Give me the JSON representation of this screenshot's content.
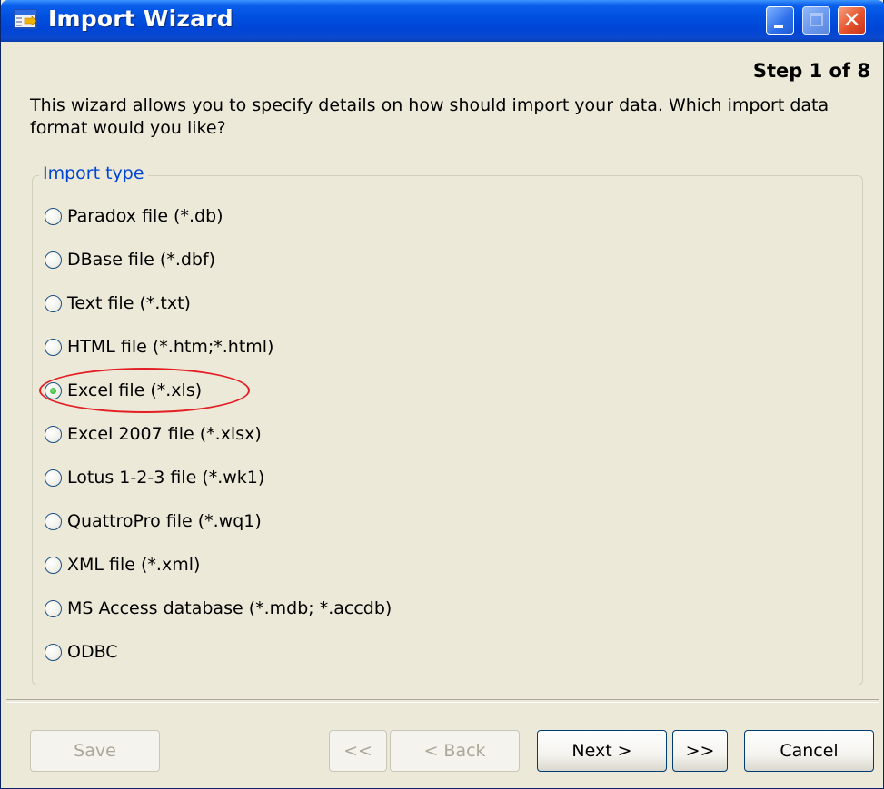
{
  "window": {
    "title": "Import Wizard",
    "step": "Step 1 of 8",
    "description": "This wizard allows you to specify details on how should import your data. Which import data format would you like?"
  },
  "import_type": {
    "label": "Import type",
    "selected": "Excel file (*.xls)",
    "options": [
      {
        "label": "Paradox file (*.db)",
        "checked": false
      },
      {
        "label": "DBase file (*.dbf)",
        "checked": false
      },
      {
        "label": "Text file (*.txt)",
        "checked": false
      },
      {
        "label": "HTML file (*.htm;*.html)",
        "checked": false
      },
      {
        "label": "Excel file (*.xls)",
        "checked": true
      },
      {
        "label": "Excel 2007 file (*.xlsx)",
        "checked": false
      },
      {
        "label": "Lotus 1-2-3 file (*.wk1)",
        "checked": false
      },
      {
        "label": "QuattroPro file (*.wq1)",
        "checked": false
      },
      {
        "label": "XML file (*.xml)",
        "checked": false
      },
      {
        "label": "MS Access database (*.mdb; *.accdb)",
        "checked": false
      },
      {
        "label": "ODBC",
        "checked": false
      }
    ]
  },
  "buttons": {
    "save": "Save",
    "first": "<<",
    "back": "< Back",
    "next": "Next >",
    "last": ">>",
    "cancel": "Cancel"
  },
  "icons": {
    "app": "import-wizard-icon",
    "minimize": "minimize-icon",
    "maximize": "maximize-icon",
    "close": "close-icon"
  },
  "colors": {
    "titlebar": "#0050E0",
    "dialog_bg": "#ECE9D8",
    "group_label": "#0046D5",
    "highlight_ring": "#E31E24",
    "radio_selected": "#21A121"
  }
}
